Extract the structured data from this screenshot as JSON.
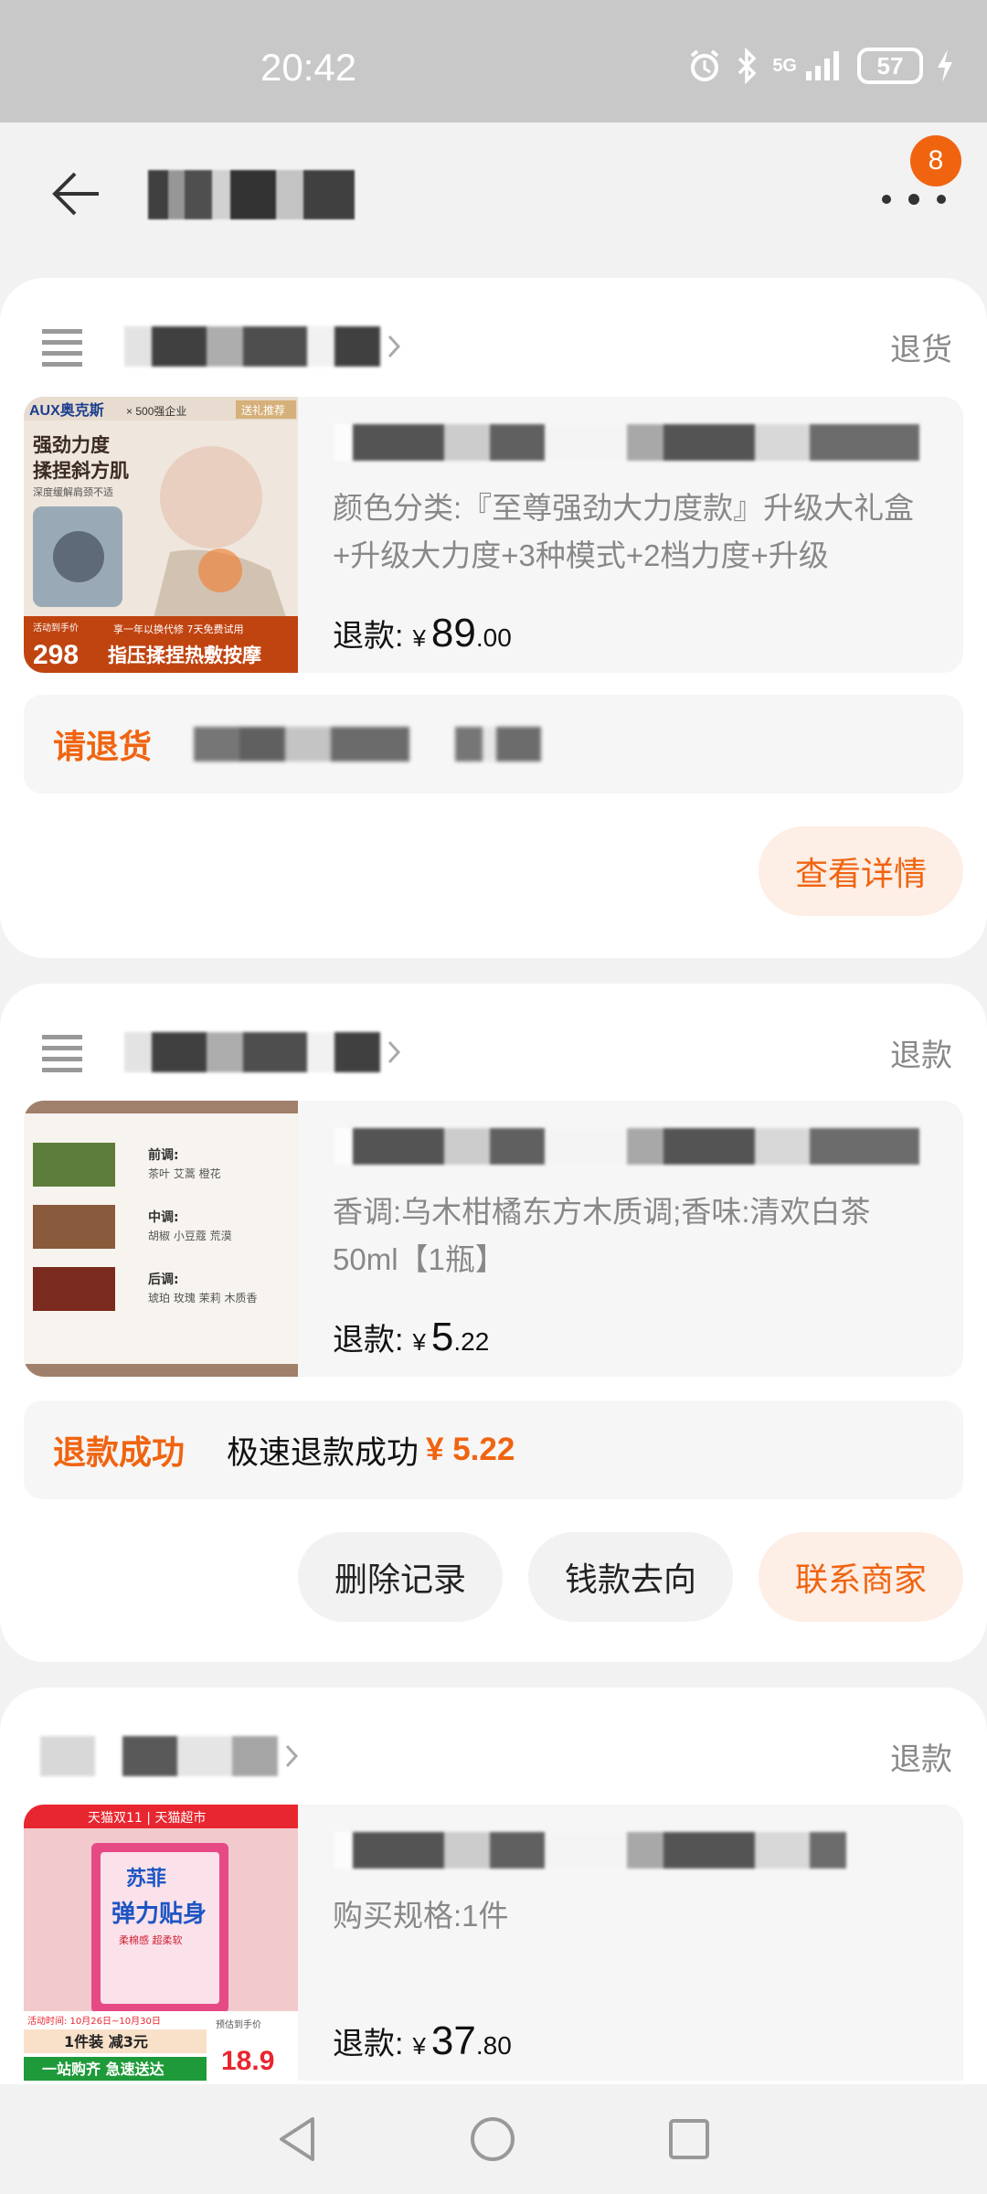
{
  "status_bar": {
    "time": "20:42",
    "network": "5G",
    "battery": "57"
  },
  "header": {
    "badge_count": "8"
  },
  "orders": [
    {
      "status": "退货",
      "spec": "颜色分类:『至尊强劲大力度款』升级大礼盒+升级大力度+3种模式+2档力度+升级",
      "refund_label": "退款:",
      "currency": "¥",
      "price_int": "89",
      "price_dec": ".00",
      "status_label": "请退货",
      "thumb": {
        "brand": "AUX奥克斯",
        "brand_note": "× 500强企业",
        "tag": "送礼推荐",
        "headline1": "强劲力度",
        "headline2": "揉捏斜方肌",
        "sub": "深度缓解肩颈不适",
        "promo_label": "活动到手价",
        "promo_price": "298",
        "promo_text": "指压揉捏热敷按摩",
        "promo_note": "享一年以换代修 7天免费试用"
      },
      "actions": [
        "查看详情"
      ]
    },
    {
      "status": "退款",
      "spec": "香调:乌木柑橘东方木质调;香味:清欢白茶50ml【1瓶】",
      "refund_label": "退款:",
      "currency": "¥",
      "price_int": "5",
      "price_dec": ".22",
      "status_label": "退款成功",
      "status_msg": "极速退款成功",
      "status_amount": "¥ 5.22",
      "thumb": {
        "notes": [
          {
            "title": "前调:",
            "desc": "茶叶 艾蒿 橙花"
          },
          {
            "title": "中调:",
            "desc": "胡椒 小豆蔻 荒漠"
          },
          {
            "title": "后调:",
            "desc": "琥珀 玫瑰 茉莉 木质香"
          }
        ]
      },
      "actions": [
        "删除记录",
        "钱款去向",
        "联系商家"
      ]
    },
    {
      "status": "退款",
      "spec": "购买规格:1件",
      "refund_label": "退款:",
      "currency": "¥",
      "price_int": "37",
      "price_dec": ".80",
      "thumb": {
        "top_banner": "天猫双11 | 天猫超市",
        "brand": "苏菲",
        "product": "弹力贴身",
        "variant": "柔棉感 超柔软",
        "promo_date": "活动时间: 10月26日~10月30日",
        "promo_deal": "1件装 减3元",
        "promo_bottom": "一站购齐 急速送达",
        "price_label": "预估到手价",
        "price": "18.9"
      }
    }
  ]
}
